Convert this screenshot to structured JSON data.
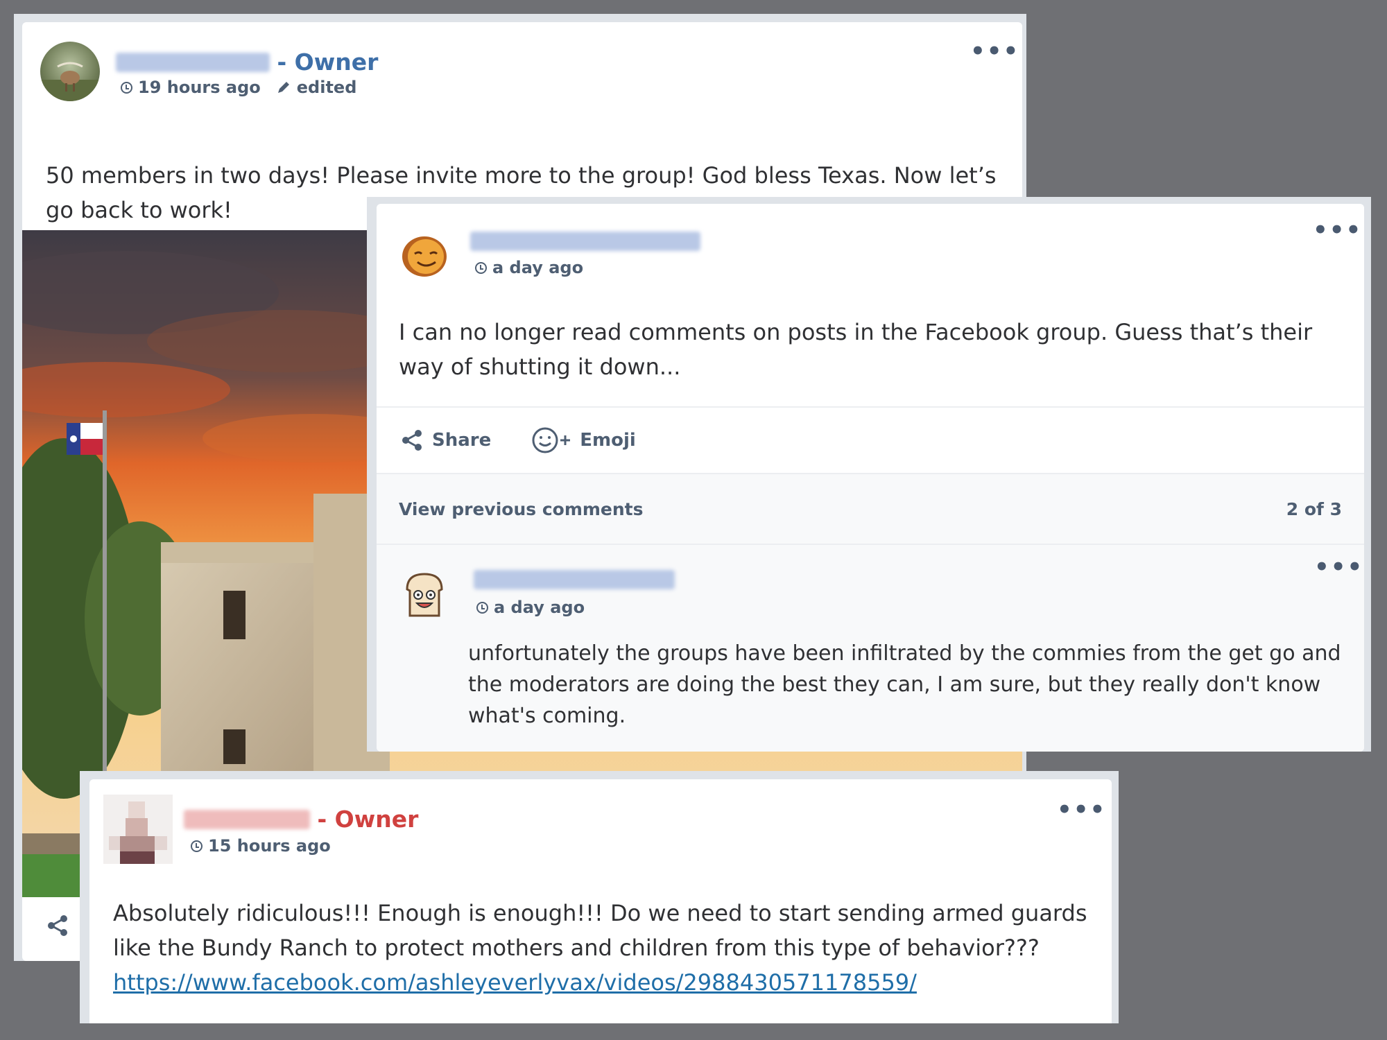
{
  "post1": {
    "author_role": "- Owner",
    "time": "19 hours ago",
    "edited_label": "edited",
    "text": "50 members in two days! Please invite more to the group! God bless Texas. Now let’s go back to work!",
    "image_alt": "Alamo with Texas flag at sunset",
    "accent": "#3e6fa8"
  },
  "post2": {
    "time": "a day ago",
    "text": "I can no longer read comments on posts in the Facebook group. Guess that’s their way of shutting it down...",
    "share_label": "Share",
    "emoji_label": "Emoji",
    "view_previous": "View previous comments",
    "comment_count": "2 of 3",
    "comment": {
      "time": "a day ago",
      "text": "unfortunately the groups have been infiltrated by the commies from the get go and the moderators are doing the best they can, I am sure, but they really don't know what's coming."
    }
  },
  "post3": {
    "author_role": "- Owner",
    "time": "15 hours ago",
    "text": "Absolutely ridiculous!!! Enough is enough!!! Do we need to start sending armed guards like the Bundy Ranch to protect mothers and children from this type of behavior???",
    "link": "https://www.facebook.com/ashleyeverlyvax/videos/2988430571178559/",
    "accent": "#d0413f"
  },
  "icons": {
    "more": "more-options-icon",
    "clock": "clock-icon",
    "pencil": "pencil-icon",
    "share": "share-icon",
    "emoji": "emoji-add-icon"
  }
}
